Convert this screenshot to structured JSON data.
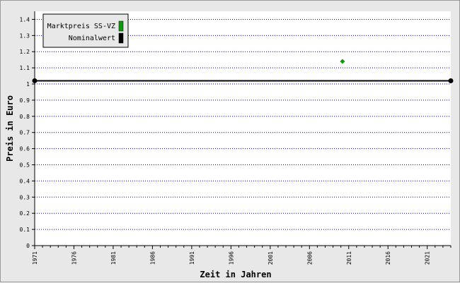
{
  "chart_data": {
    "type": "scatter",
    "xlabel": "Zeit in Jahren",
    "ylabel": "Preis in Euro",
    "xlim": [
      1971,
      2024
    ],
    "ylim": [
      0,
      1.45
    ],
    "x_ticks": [
      1971,
      1976,
      1981,
      1986,
      1991,
      1996,
      2001,
      2006,
      2011,
      2016,
      2021
    ],
    "y_ticks": [
      0,
      0.1,
      0.2,
      0.3,
      0.4,
      0.5,
      0.6,
      0.7,
      0.8,
      0.9,
      1,
      1.1,
      1.2,
      1.3,
      1.4
    ],
    "grid": "horizontal dotted",
    "legend_position": "top-left",
    "series": [
      {
        "name": "Marktpreis SS-VZ",
        "color": "#109910",
        "marker": "diamond",
        "points": [
          {
            "x": 2010.2,
            "y": 1.14
          }
        ]
      },
      {
        "name": "Nominalwert",
        "color": "#000000",
        "marker": "line",
        "points": [
          {
            "x": 1971,
            "y": 1.02
          },
          {
            "x": 2024,
            "y": 1.02
          }
        ]
      }
    ],
    "colors": {
      "grid": "#0000cc",
      "background": "#ffffff",
      "frame": "#e8e8e8"
    }
  }
}
